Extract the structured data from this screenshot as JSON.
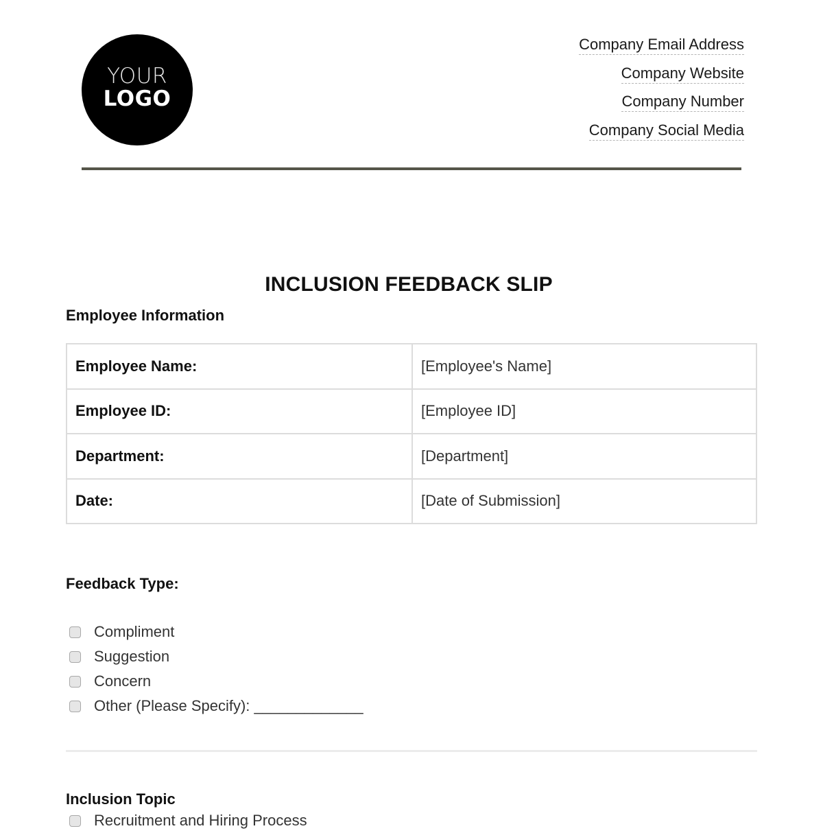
{
  "header": {
    "logo": {
      "line1": "YOUR",
      "line2": "LOGO"
    },
    "contact": [
      "Company Email Address",
      "Company Website",
      "Company Number",
      "Company Social Media"
    ]
  },
  "document": {
    "title": "INCLUSION FEEDBACK SLIP",
    "employee_section": {
      "heading": "Employee Information",
      "rows": [
        {
          "label": "Employee Name:",
          "value": "[Employee's Name]"
        },
        {
          "label": "Employee ID:",
          "value": "[Employee ID]"
        },
        {
          "label": "Department:",
          "value": "[Department]"
        },
        {
          "label": "Date:",
          "value": "[Date of Submission]"
        }
      ]
    },
    "feedback_type": {
      "heading": "Feedback Type:",
      "options": [
        {
          "label": "Compliment",
          "checked": false
        },
        {
          "label": "Suggestion",
          "checked": false
        },
        {
          "label": "Concern",
          "checked": false
        },
        {
          "label": "Other (Please Specify): _____________",
          "checked": false
        }
      ]
    },
    "inclusion_topic": {
      "heading": "Inclusion Topic",
      "options": [
        {
          "label": "Recruitment and Hiring Process",
          "checked": false
        }
      ]
    }
  }
}
